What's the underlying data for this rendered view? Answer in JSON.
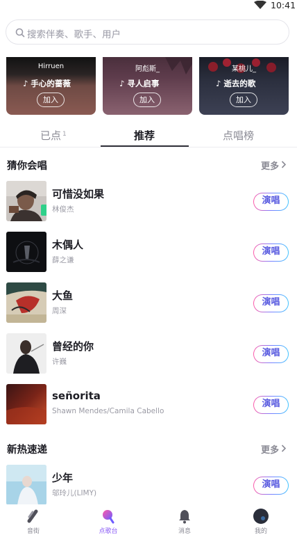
{
  "status_bar": {
    "time": "10:41"
  },
  "search": {
    "placeholder": "搜索伴奏、歌手、用户"
  },
  "featured_cards": [
    {
      "artist": "Hirruen",
      "title": "手心的蔷薇",
      "join_label": "加入"
    },
    {
      "artist": "阿彪斯_",
      "title": "寻人启事",
      "join_label": "加入"
    },
    {
      "artist": "某桃儿_",
      "title": "逝去的歌",
      "join_label": "加入"
    }
  ],
  "tabs": [
    {
      "label": "已点",
      "count": "1"
    },
    {
      "label": "推荐"
    },
    {
      "label": "点唱榜"
    }
  ],
  "active_tab": "推荐",
  "sections": {
    "guess": {
      "title": "猜你会唱",
      "more": "更多"
    },
    "new_hot": {
      "title": "新热速递",
      "more": "更多"
    }
  },
  "songs": [
    {
      "name": "可惜没如果",
      "singer": "林俊杰",
      "button": "演唱"
    },
    {
      "name": "木偶人",
      "singer": "薛之谦",
      "button": "演唱"
    },
    {
      "name": "大鱼",
      "singer": "周深",
      "button": "演唱"
    },
    {
      "name": "曾经的你",
      "singer": "许巍",
      "button": "演唱"
    },
    {
      "name": "señorita",
      "singer": "Shawn Mendes/Camila Cabello",
      "button": "演唱"
    }
  ],
  "new_songs": [
    {
      "name": "少年",
      "singer": "邬玲儿(LIMY)",
      "button": "演唱"
    }
  ],
  "bottom_nav": [
    {
      "label": "音街",
      "icon": "music-street-icon"
    },
    {
      "label": "点歌台",
      "icon": "microphone-icon"
    },
    {
      "label": "消息",
      "icon": "bell-icon"
    },
    {
      "label": "我的",
      "icon": "avatar-icon"
    }
  ],
  "colors": {
    "accent_purple": "#8b5cf6",
    "sing_button_gradient": [
      "#ff5aa8",
      "#7a7dff",
      "#3fc4ff"
    ],
    "text_primary": "#1d1d24",
    "text_secondary": "#9a9aa4"
  }
}
